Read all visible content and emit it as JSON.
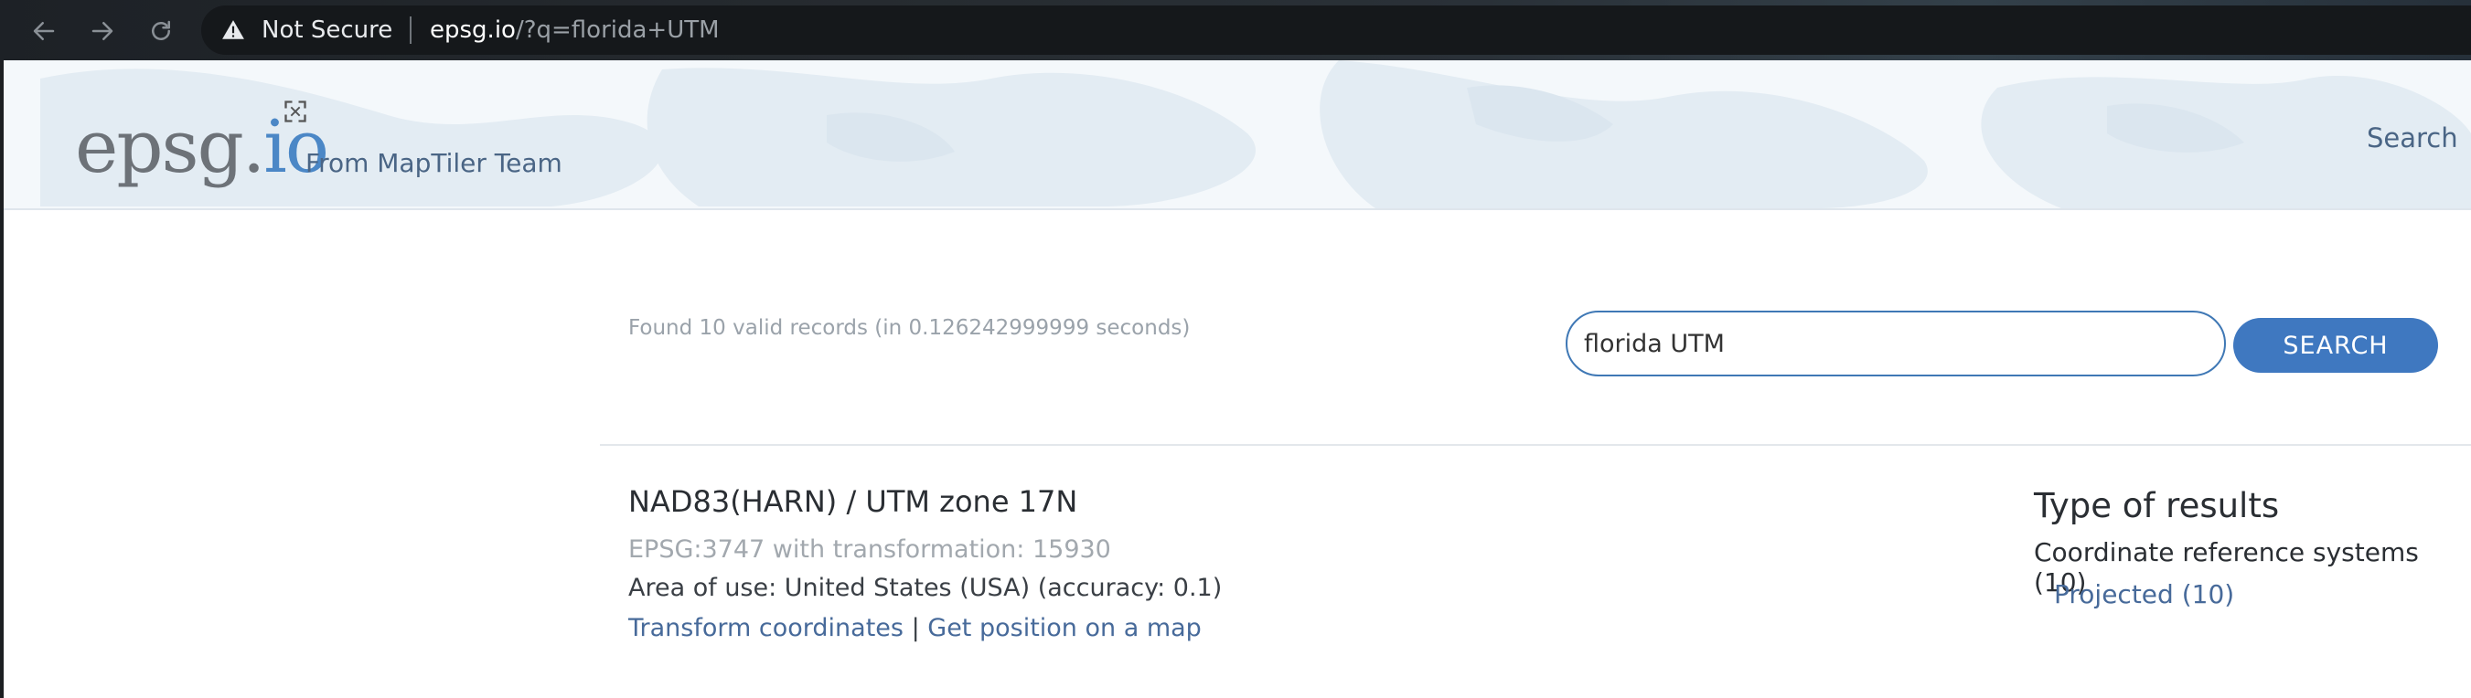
{
  "browser": {
    "back_icon": "arrow-left-icon",
    "forward_icon": "arrow-right-icon",
    "reload_icon": "reload-icon",
    "security_label": "Not Secure",
    "url_host": "epsg.io",
    "url_path": "/?q=florida+UTM"
  },
  "header": {
    "logo_main": "epsg.",
    "logo_accent": "io",
    "tagline": "From MapTiler Team",
    "nav_search": "Search",
    "accent_color": "#4b87c6"
  },
  "search": {
    "found_text": "Found 10 valid records (in 0.126242999999 seconds)",
    "query": "florida UTM",
    "button_label": "SEARCH"
  },
  "results": [
    {
      "title": "NAD83(HARN) / UTM zone 17N",
      "code": "EPSG:3747 with transformation: 15930",
      "area": "Area of use: United States (USA) (accuracy: 0.1)",
      "link_transform": "Transform coordinates",
      "link_separator": "|",
      "link_map": "Get position on a map"
    }
  ],
  "facets": {
    "title": "Type of results",
    "crs": "Coordinate reference systems (10)",
    "projected": "Projected (10)"
  }
}
